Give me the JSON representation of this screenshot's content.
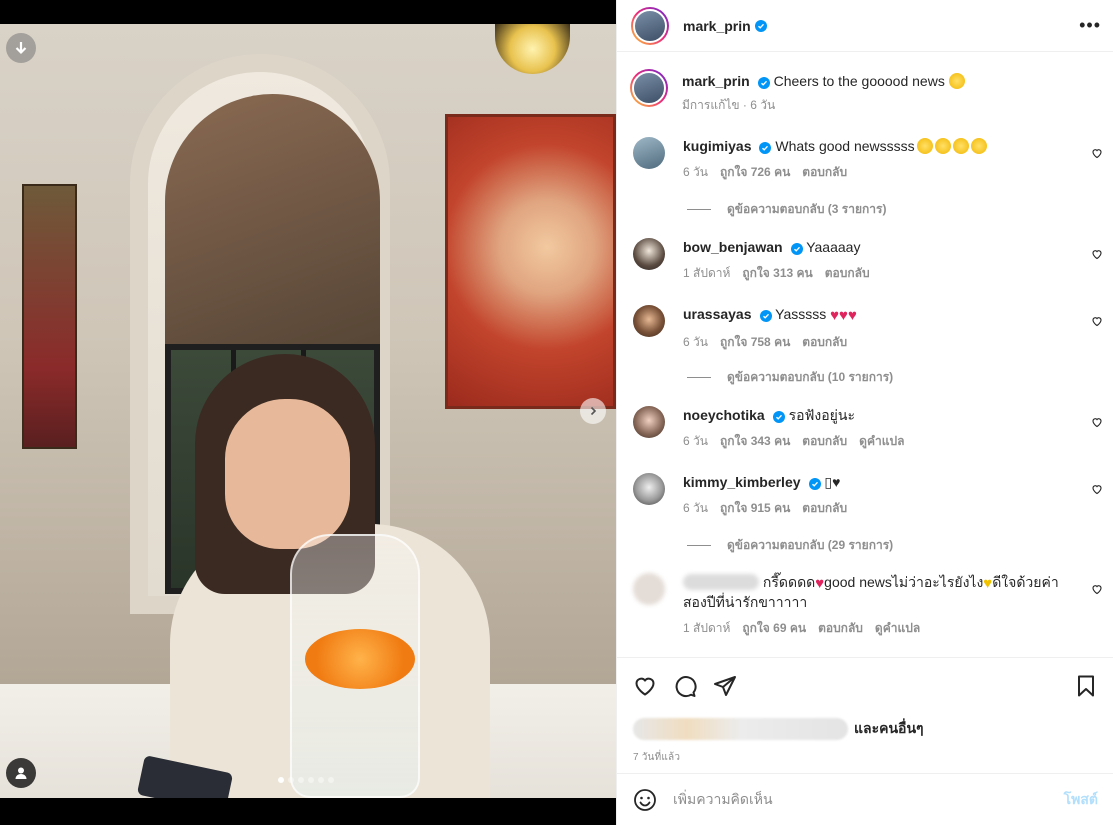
{
  "post": {
    "author": "mark_prin",
    "caption": "Cheers to the gooood news",
    "caption_emoji": "grinning-face",
    "edited_time": "มีการแก้ไข · 6 วัน",
    "carousel_total": 6,
    "carousel_index": 1
  },
  "comments": [
    {
      "username": "kugimiyas",
      "text": "Whats good newsssss",
      "emoji": [
        "smiling-face-with-hearts",
        "smiling-face-with-hearts",
        "smiling-face-with-hearts",
        "smiling-face-with-hearts"
      ],
      "time": "6 วัน",
      "likes": "ถูกใจ 726 คน",
      "reply": "ตอบกลับ",
      "view_replies": "ดูข้อความตอบกลับ (3 รายการ)"
    },
    {
      "username": "bow_benjawan",
      "text": "Yaaaaay",
      "time": "1 สัปดาห์",
      "likes": "ถูกใจ 313 คน",
      "reply": "ตอบกลับ"
    },
    {
      "username": "urassayas",
      "text": "Yasssss",
      "emoji": [
        "red-heart",
        "red-heart",
        "red-heart"
      ],
      "time": "6 วัน",
      "likes": "ถูกใจ 758 คน",
      "reply": "ตอบกลับ",
      "view_replies": "ดูข้อความตอบกลับ (10 รายการ)"
    },
    {
      "username": "noeychotika",
      "text": "รอฟังอยู่นะ",
      "time": "6 วัน",
      "likes": "ถูกใจ 343 คน",
      "reply": "ตอบกลับ",
      "translate": "ดูคำแปล"
    },
    {
      "username": "kimmy_kimberley",
      "text": "▯♥",
      "time": "6 วัน",
      "likes": "ถูกใจ 915 คน",
      "reply": "ตอบกลับ",
      "view_replies": "ดูข้อความตอบกลับ (29 รายการ)"
    },
    {
      "username": "",
      "text_part1": "กรี๊ดดดด",
      "text_part2": "good newsไม่ว่าอะไรยังไง",
      "text_part3": "ดีใจด้วยค่า",
      "text_line2": "สองปีที่น่ารักขาาาาา",
      "time": "1 สัปดาห์",
      "likes": "ถูกใจ 69 คน",
      "reply": "ตอบกลับ",
      "translate": "ดูคำแปล"
    }
  ],
  "likes_summary": {
    "others": "และคนอื่นๆ",
    "time_ago": "7 วันที่แล้ว"
  },
  "comment_box": {
    "placeholder": "เพิ่มความคิดเห็น",
    "post_label": "โพสต์"
  },
  "colors": {
    "verified": "#0095f6",
    "heart": "#e0245e",
    "post_disabled": "#b2dffc"
  }
}
